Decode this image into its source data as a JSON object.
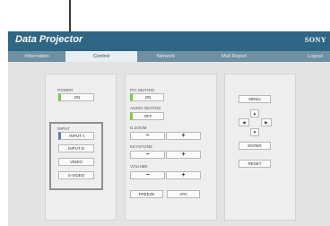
{
  "header": {
    "title": "Data Projector",
    "brand": "SONY"
  },
  "tabs": [
    {
      "label": "Information",
      "active": false
    },
    {
      "label": "Control",
      "active": true
    },
    {
      "label": "Network",
      "active": false
    },
    {
      "label": "Mail Report",
      "active": false
    }
  ],
  "logout_label": "Logout",
  "power": {
    "label": "POWER",
    "button": "ON"
  },
  "input": {
    "label": "INPUT",
    "options": [
      "INPUT A",
      "INPUT B",
      "VIDEO",
      "S-VIDEO"
    ]
  },
  "pic_muting": {
    "label": "PIC MUTING",
    "button": "ON"
  },
  "audio_muting": {
    "label": "AUDIO MUTING",
    "button": "OFF"
  },
  "d_zoom": {
    "label": "D ZOOM",
    "minus": "−",
    "plus": "+"
  },
  "keystone": {
    "label": "KEYSTONE",
    "minus": "−",
    "plus": "+"
  },
  "volume": {
    "label": "VOLUME",
    "minus": "−",
    "plus": "+"
  },
  "freeze_label": "FREEZE",
  "apa_label": "APA",
  "menu_label": "MENU",
  "arrows": {
    "up": "▲",
    "left": "◀",
    "right": "▶",
    "down": "▼"
  },
  "enter_label": "ENTER",
  "reset_label": "RESET",
  "colors": {
    "header": "#2f6685",
    "tabbar": "#6f8fa3",
    "indicator_on": "#7ec94e",
    "indicator_selected": "#4a7fbe"
  }
}
